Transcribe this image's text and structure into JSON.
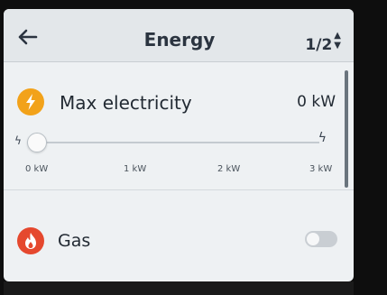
{
  "header": {
    "back_icon": "arrow-left-icon",
    "title": "Energy",
    "pager": "1/2",
    "pager_icon": "up-down-arrows-icon"
  },
  "electricity": {
    "icon": "lightning-bolt-icon",
    "icon_color": "#f2a21a",
    "label": "Max electricity",
    "value": "0 kW",
    "slider": {
      "level": 0,
      "min_icon": "small-bolt-icon",
      "max_icon": "bolt-icon",
      "ticks": [
        "0 kW",
        "1 kW",
        "2 kW",
        "3 kW"
      ]
    }
  },
  "gas": {
    "icon": "flame-icon",
    "icon_color": "#e5482e",
    "label": "Gas",
    "toggle_on": false
  }
}
